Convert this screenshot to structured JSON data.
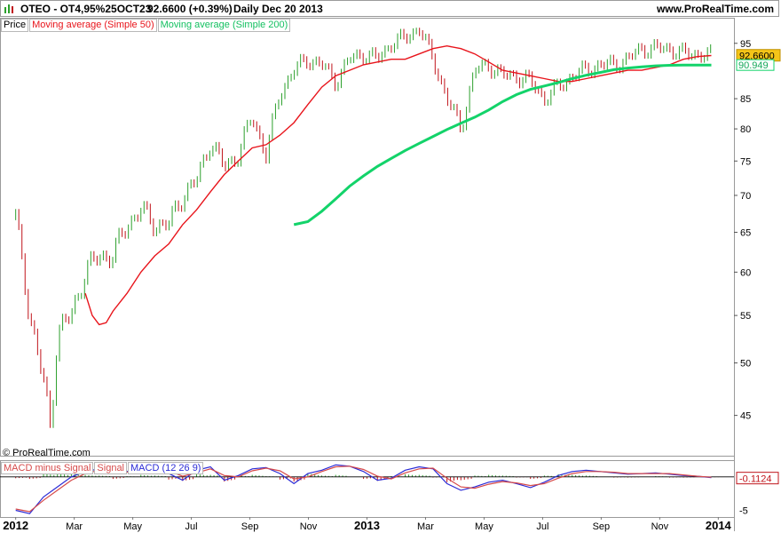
{
  "header": {
    "instrument": "OTEO - OT4,95%25OCT23",
    "price_change": "92.6600 (+0.39%)",
    "period_date": "Daily  Dec 20 2013",
    "site": "www.ProRealTime.com",
    "icon": "bar-chart-icon"
  },
  "legend": {
    "price": "Price",
    "ma50": "Moving average (Simple 50)",
    "ma200": "Moving average (Simple 200)"
  },
  "macd_legend": {
    "hist": "MACD minus Signal",
    "signal": "Signal",
    "macd": "MACD (12 26 9)"
  },
  "copyright": "© ProRealTime.com",
  "colors": {
    "ma50": "#e8141b",
    "ma200": "#13d36a",
    "up_bar": "#2ca02c",
    "down_bar": "#c0141b",
    "macd": "#2b2bd6",
    "signal": "#d64a4a",
    "last_price_bg": "#f5c518"
  },
  "chart_data": [
    {
      "type": "line",
      "panel": "price",
      "y_scale": "log",
      "ylim": [
        41.5,
        100
      ],
      "yticks": [
        "45",
        "50",
        "55",
        "60",
        "65",
        "70",
        "75",
        "80",
        "85",
        "95"
      ],
      "x_tick_labels": [
        "2012",
        "Mar",
        "May",
        "Jul",
        "Sep",
        "Nov",
        "2013",
        "Mar",
        "May",
        "Jul",
        "Sep",
        "Nov",
        "2014"
      ],
      "x_range": [
        -2,
        103
      ],
      "last_price_label": "92.6600",
      "ma200_label": "90.949",
      "series": [
        {
          "name": "Price",
          "x": [
            0,
            2,
            4,
            5,
            6,
            8,
            10,
            12,
            14,
            16,
            18,
            20,
            22,
            24,
            26,
            28,
            30,
            32,
            34,
            36,
            38,
            39,
            40,
            42,
            44,
            46,
            48,
            50,
            52,
            54,
            56,
            58,
            60,
            62,
            64,
            66,
            68,
            70,
            72,
            74,
            76,
            78,
            80,
            82,
            84,
            86,
            88,
            90,
            92,
            94,
            96,
            98,
            100
          ],
          "values": [
            67,
            55,
            48,
            44,
            53,
            55,
            60,
            62,
            62,
            66,
            68,
            66,
            66,
            70,
            72,
            78,
            74,
            76,
            82,
            76,
            86,
            88,
            90,
            92,
            91,
            88,
            92,
            93,
            92,
            95,
            96,
            98,
            92,
            85,
            80,
            90,
            91,
            89,
            89,
            88,
            85,
            87,
            89,
            90,
            91,
            91,
            92,
            94,
            94,
            94,
            93,
            93,
            92.66
          ]
        },
        {
          "name": "Moving average (Simple 50)",
          "x": [
            10,
            11,
            12,
            13,
            14,
            16,
            18,
            20,
            22,
            24,
            26,
            28,
            30,
            32,
            34,
            36,
            38,
            40,
            42,
            44,
            46,
            48,
            50,
            52,
            54,
            56,
            58,
            60,
            62,
            64,
            66,
            68,
            70,
            72,
            74,
            76,
            78,
            80,
            82,
            84,
            86,
            88,
            90,
            92,
            94,
            96,
            98,
            100
          ],
          "values": [
            57.5,
            55,
            54,
            54.2,
            55.5,
            57.5,
            60,
            62,
            63.5,
            66,
            68,
            70.5,
            73,
            75,
            77,
            77.5,
            79,
            81,
            84,
            87,
            89,
            90,
            91,
            91.5,
            92,
            92,
            93,
            94,
            94.5,
            94,
            93,
            91.5,
            90,
            89.5,
            89,
            88.5,
            88,
            88,
            88.5,
            89,
            89.5,
            90,
            90,
            90.5,
            91,
            92,
            92.5,
            92.7
          ]
        },
        {
          "name": "Moving average (Simple 200)",
          "x": [
            40,
            42,
            44,
            46,
            48,
            50,
            52,
            54,
            56,
            58,
            60,
            62,
            64,
            66,
            68,
            70,
            72,
            74,
            76,
            78,
            80,
            82,
            84,
            86,
            88,
            90,
            92,
            94,
            96,
            98,
            100
          ],
          "values": [
            66,
            66.4,
            67.8,
            69.5,
            71.3,
            72.8,
            74.2,
            75.4,
            76.6,
            77.7,
            78.8,
            79.9,
            80.9,
            81.9,
            83.1,
            84.5,
            85.7,
            86.6,
            87.2,
            87.8,
            88.5,
            89.1,
            89.6,
            90.1,
            90.4,
            90.6,
            90.8,
            90.9,
            90.95,
            90.95,
            90.949
          ]
        }
      ]
    },
    {
      "type": "line",
      "panel": "macd",
      "ylim": [
        -6,
        2.5
      ],
      "yticks": [
        "-5"
      ],
      "last_value_label": "-0.1124",
      "x": [
        0,
        2,
        4,
        6,
        8,
        10,
        12,
        14,
        16,
        18,
        20,
        22,
        24,
        26,
        28,
        30,
        32,
        34,
        36,
        38,
        40,
        42,
        44,
        46,
        48,
        50,
        52,
        54,
        56,
        58,
        60,
        62,
        64,
        66,
        68,
        70,
        72,
        74,
        76,
        78,
        80,
        82,
        84,
        86,
        88,
        90,
        92,
        94,
        96,
        98,
        100
      ],
      "series": [
        {
          "name": "MACD (12 26 9)",
          "values": [
            -5,
            -5.5,
            -3,
            -1.5,
            0,
            0.8,
            1.2,
            0.5,
            0.8,
            1.5,
            1.8,
            0.5,
            -0.5,
            1,
            1.5,
            -0.5,
            0.2,
            1.2,
            1.4,
            0.5,
            -1,
            0.5,
            1,
            1.8,
            1.6,
            0.8,
            -0.5,
            -0.2,
            1,
            1.5,
            1.2,
            -1,
            -2,
            -1.5,
            -0.8,
            -0.5,
            -1,
            -1.6,
            -0.8,
            0.2,
            0.8,
            1,
            0.8,
            0.6,
            0.4,
            0.5,
            0.6,
            0.4,
            0.2,
            0.1,
            -0.1
          ]
        },
        {
          "name": "Signal",
          "values": [
            -4.8,
            -5.2,
            -3.5,
            -2,
            -0.5,
            0.5,
            1,
            0.8,
            0.7,
            1.2,
            1.6,
            0.9,
            0.1,
            0.6,
            1.2,
            0.2,
            0,
            0.9,
            1.3,
            0.9,
            -0.3,
            0,
            0.8,
            1.5,
            1.6,
            1.1,
            0.1,
            -0.3,
            0.6,
            1.2,
            1.3,
            -0.2,
            -1.5,
            -1.7,
            -1.1,
            -0.7,
            -0.9,
            -1.3,
            -1,
            -0.2,
            0.5,
            0.8,
            0.8,
            0.7,
            0.5,
            0.5,
            0.5,
            0.5,
            0.3,
            0.1,
            -0.05
          ]
        }
      ]
    }
  ]
}
